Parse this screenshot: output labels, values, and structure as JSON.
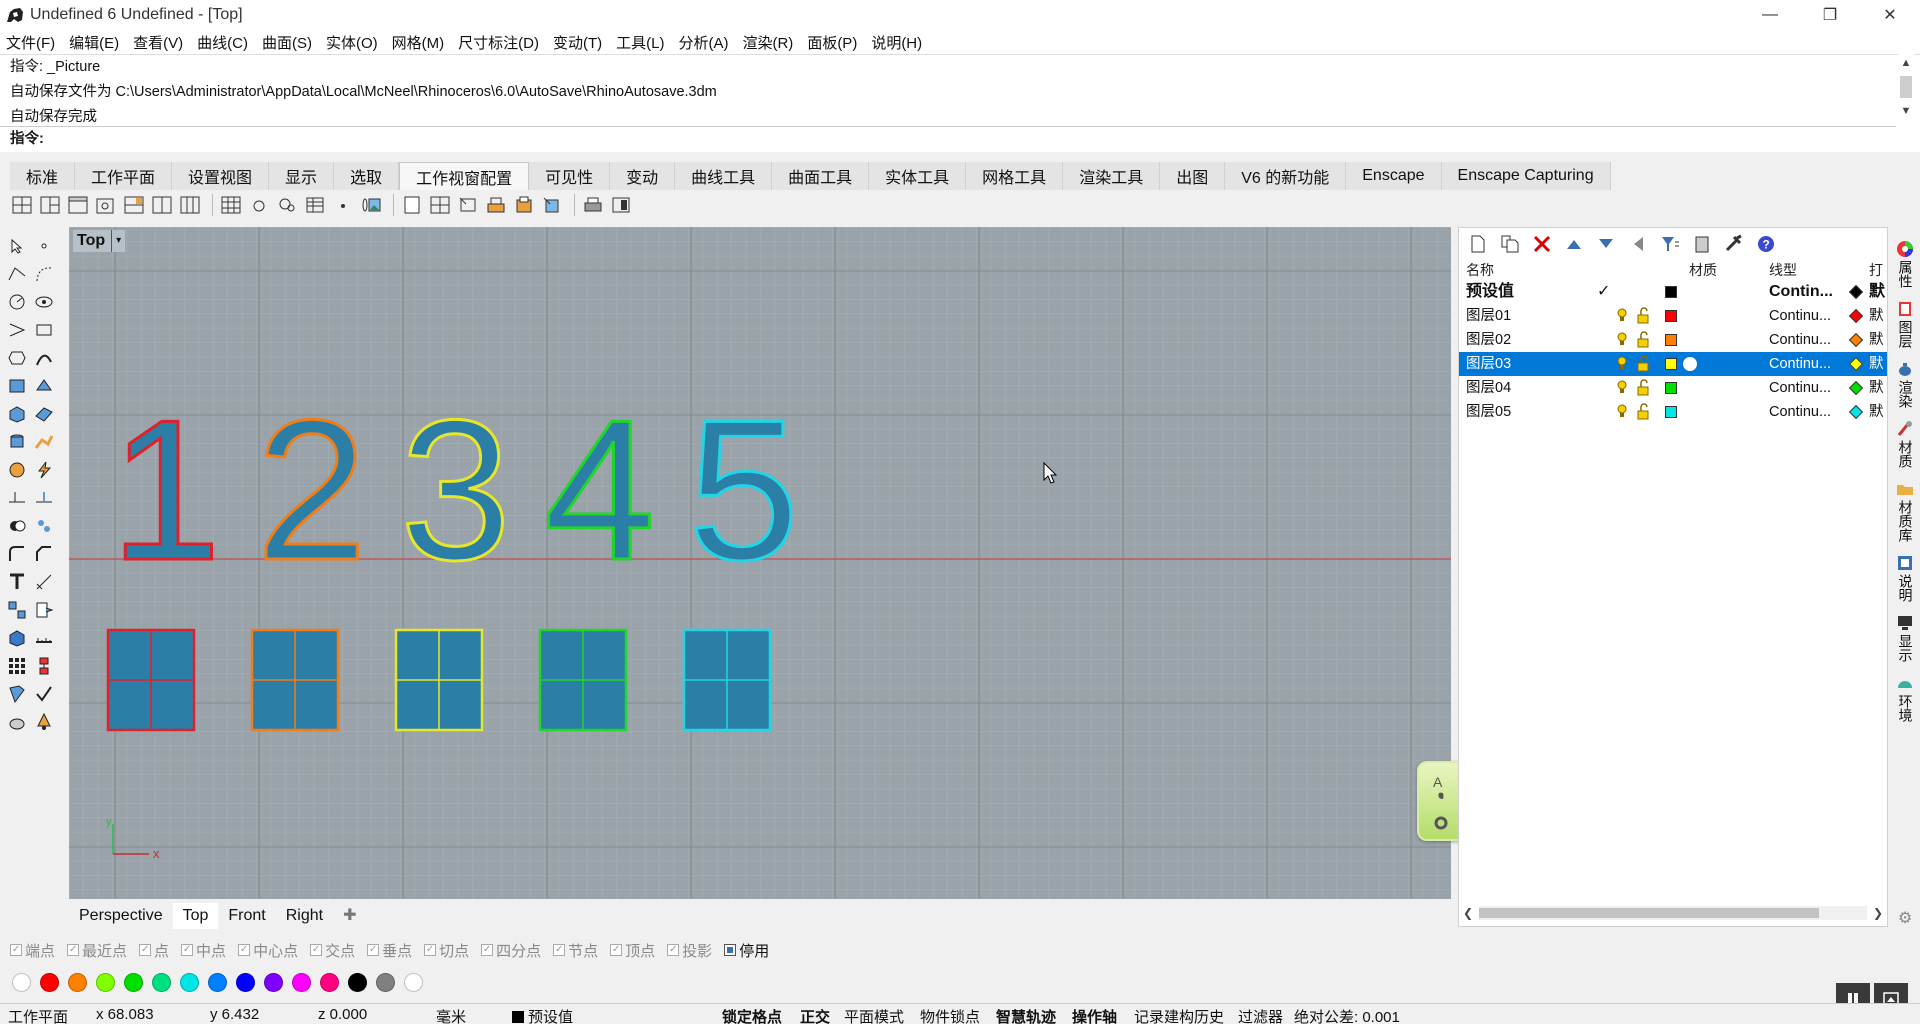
{
  "window": {
    "title": "Undefined 6 Undefined - [Top]",
    "minimize": "—",
    "restore": "❐",
    "close": "✕"
  },
  "menu": [
    "文件(F)",
    "编辑(E)",
    "查看(V)",
    "曲线(C)",
    "曲面(S)",
    "实体(O)",
    "网格(M)",
    "尺寸标注(D)",
    "变动(T)",
    "工具(L)",
    "分析(A)",
    "渲染(R)",
    "面板(P)",
    "说明(H)"
  ],
  "command": {
    "history": [
      "指令: _Picture",
      "自动保存文件为 C:\\Users\\Administrator\\AppData\\Local\\McNeel\\Rhinoceros\\6.0\\AutoSave\\RhinoAutosave.3dm",
      "自动保存完成"
    ],
    "prompt": "指令:"
  },
  "tabs": [
    "标准",
    "工作平面",
    "设置视图",
    "显示",
    "选取",
    "工作视窗配置",
    "可见性",
    "变动",
    "曲线工具",
    "曲面工具",
    "实体工具",
    "网格工具",
    "渲染工具",
    "出图",
    "V6 的新功能",
    "Enscape",
    "Enscape Capturing"
  ],
  "active_tab": "工作视窗配置",
  "viewport": {
    "label": "Top",
    "dropdown": "▾",
    "digits": [
      "1",
      "2",
      "3",
      "4",
      "5"
    ],
    "digit_colors": [
      "#e0202a",
      "#f07d18",
      "#e6e62a",
      "#20d62a",
      "#20d6e6"
    ],
    "fill_color": "#2b7fa6",
    "axis_x": "x",
    "axis_y": "y"
  },
  "viewport_tabs": [
    "Perspective",
    "Top",
    "Front",
    "Right",
    "✚"
  ],
  "active_viewport_tab": "Top",
  "layers": {
    "headers": {
      "name": "名称",
      "material": "材质",
      "linetype": "线型",
      "print": "打"
    },
    "rows": [
      {
        "name": "预设值",
        "check": "✓",
        "color": "#000000",
        "linetype": "Contin...",
        "print_color": "#000000",
        "print": "默",
        "bold": true,
        "selected": false,
        "show_icons": false
      },
      {
        "name": "图层01",
        "check": "",
        "color": "#ff0000",
        "linetype": "Continu...",
        "print_color": "#ff0000",
        "print": "默",
        "bold": false,
        "selected": false,
        "show_icons": true
      },
      {
        "name": "图层02",
        "check": "",
        "color": "#ff7f00",
        "linetype": "Continu...",
        "print_color": "#ff7f00",
        "print": "默",
        "bold": false,
        "selected": false,
        "show_icons": true
      },
      {
        "name": "图层03",
        "check": "",
        "color": "#ffff00",
        "linetype": "Continu...",
        "print_color": "#ffff00",
        "print": "默",
        "bold": false,
        "selected": true,
        "show_icons": true
      },
      {
        "name": "图层04",
        "check": "",
        "color": "#00e000",
        "linetype": "Continu...",
        "print_color": "#00e000",
        "print": "默",
        "bold": false,
        "selected": false,
        "show_icons": true
      },
      {
        "name": "图层05",
        "check": "",
        "color": "#00e5e5",
        "linetype": "Continu...",
        "print_color": "#00e5e5",
        "print": "默",
        "bold": false,
        "selected": false,
        "show_icons": true
      }
    ]
  },
  "right_strip": [
    "属性",
    "图层",
    "渲染",
    "材质",
    "材质库",
    "说明",
    "显示",
    "环境"
  ],
  "osnaps": [
    {
      "label": "端点",
      "on": false
    },
    {
      "label": "最近点",
      "on": false
    },
    {
      "label": "点",
      "on": false
    },
    {
      "label": "中点",
      "on": false
    },
    {
      "label": "中心点",
      "on": false
    },
    {
      "label": "交点",
      "on": false
    },
    {
      "label": "垂点",
      "on": false
    },
    {
      "label": "切点",
      "on": false
    },
    {
      "label": "四分点",
      "on": false
    },
    {
      "label": "节点",
      "on": false
    },
    {
      "label": "顶点",
      "on": false
    },
    {
      "label": "投影",
      "on": false
    },
    {
      "label": "停用",
      "on": true
    }
  ],
  "palette": [
    "#ffffff",
    "#ff0000",
    "#ff8000",
    "#80ff00",
    "#00e000",
    "#00e080",
    "#00e5e5",
    "#0080ff",
    "#0000ff",
    "#8000ff",
    "#ff00ff",
    "#ff0080",
    "#000000",
    "#808080",
    "#ffffff"
  ],
  "status": {
    "cplane": "工作平面",
    "x": "x 68.083",
    "y": "y 6.432",
    "z": "z 0.000",
    "unit": "毫米",
    "layer": "预设值",
    "grid_snap": "锁定格点",
    "ortho": "正交",
    "planar": "平面模式",
    "osnap": "物件锁点",
    "smarttrack": "智慧轨迹",
    "gumball": "操作轴",
    "history": "记录建构历史",
    "filter": "过滤器",
    "tolerance": "绝对公差: 0.001"
  },
  "icons": {
    "app": "rhino-app-icon",
    "settings": "⚙"
  }
}
